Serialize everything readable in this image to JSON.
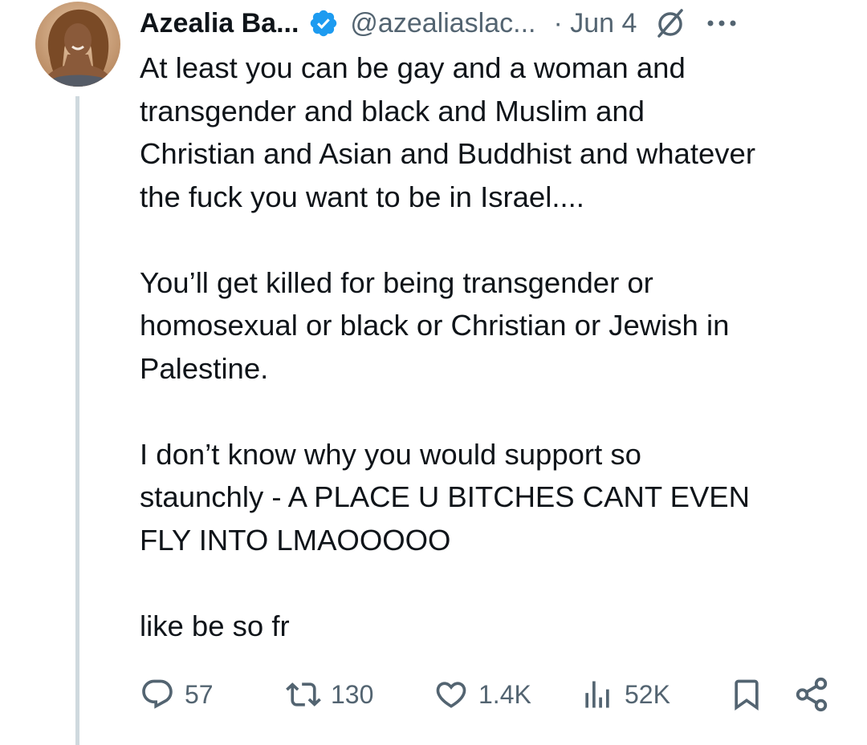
{
  "tweet": {
    "author_name": "Azealia Ba...",
    "handle": "@azealiaslac...",
    "date": "· Jun 4",
    "text": "At least you can be gay and a woman and\ntransgender and black and Muslim and\nChristian and Asian and Buddhist and whatever\nthe fuck you want to be in Israel....\n\nYou’ll get killed for being transgender or\nhomosexual or black or Christian or Jewish in\nPalestine.\n\nI don’t know why you would support so\nstaunchly - A PLACE U BITCHES CANT EVEN\nFLY INTO LMAOOOOO\n\nlike be so fr"
  },
  "stats": {
    "replies": "57",
    "reposts": "130",
    "likes": "1.4K",
    "views": "52K"
  },
  "colors": {
    "text": "#0f1419",
    "secondary": "#536471",
    "verified": "#1d9bf0",
    "thread_line": "#cfd9de"
  },
  "icons": {
    "verified": "verified-badge-icon",
    "grok": "grok-icon",
    "more": "more-icon",
    "reply": "reply-icon",
    "repost": "repost-icon",
    "like": "heart-icon",
    "views": "views-icon",
    "bookmark": "bookmark-icon",
    "share": "share-icon"
  }
}
